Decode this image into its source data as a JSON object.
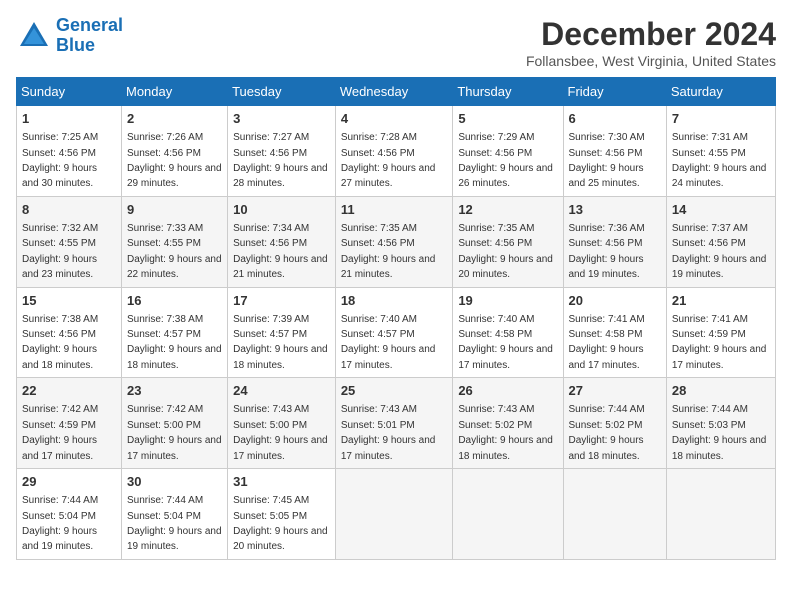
{
  "logo": {
    "line1": "General",
    "line2": "Blue"
  },
  "title": "December 2024",
  "subtitle": "Follansbee, West Virginia, United States",
  "days_of_week": [
    "Sunday",
    "Monday",
    "Tuesday",
    "Wednesday",
    "Thursday",
    "Friday",
    "Saturday"
  ],
  "weeks": [
    [
      {
        "day": "1",
        "sunrise": "7:25 AM",
        "sunset": "4:56 PM",
        "daylight": "9 hours and 30 minutes."
      },
      {
        "day": "2",
        "sunrise": "7:26 AM",
        "sunset": "4:56 PM",
        "daylight": "9 hours and 29 minutes."
      },
      {
        "day": "3",
        "sunrise": "7:27 AM",
        "sunset": "4:56 PM",
        "daylight": "9 hours and 28 minutes."
      },
      {
        "day": "4",
        "sunrise": "7:28 AM",
        "sunset": "4:56 PM",
        "daylight": "9 hours and 27 minutes."
      },
      {
        "day": "5",
        "sunrise": "7:29 AM",
        "sunset": "4:56 PM",
        "daylight": "9 hours and 26 minutes."
      },
      {
        "day": "6",
        "sunrise": "7:30 AM",
        "sunset": "4:56 PM",
        "daylight": "9 hours and 25 minutes."
      },
      {
        "day": "7",
        "sunrise": "7:31 AM",
        "sunset": "4:55 PM",
        "daylight": "9 hours and 24 minutes."
      }
    ],
    [
      {
        "day": "8",
        "sunrise": "7:32 AM",
        "sunset": "4:55 PM",
        "daylight": "9 hours and 23 minutes."
      },
      {
        "day": "9",
        "sunrise": "7:33 AM",
        "sunset": "4:55 PM",
        "daylight": "9 hours and 22 minutes."
      },
      {
        "day": "10",
        "sunrise": "7:34 AM",
        "sunset": "4:56 PM",
        "daylight": "9 hours and 21 minutes."
      },
      {
        "day": "11",
        "sunrise": "7:35 AM",
        "sunset": "4:56 PM",
        "daylight": "9 hours and 21 minutes."
      },
      {
        "day": "12",
        "sunrise": "7:35 AM",
        "sunset": "4:56 PM",
        "daylight": "9 hours and 20 minutes."
      },
      {
        "day": "13",
        "sunrise": "7:36 AM",
        "sunset": "4:56 PM",
        "daylight": "9 hours and 19 minutes."
      },
      {
        "day": "14",
        "sunrise": "7:37 AM",
        "sunset": "4:56 PM",
        "daylight": "9 hours and 19 minutes."
      }
    ],
    [
      {
        "day": "15",
        "sunrise": "7:38 AM",
        "sunset": "4:56 PM",
        "daylight": "9 hours and 18 minutes."
      },
      {
        "day": "16",
        "sunrise": "7:38 AM",
        "sunset": "4:57 PM",
        "daylight": "9 hours and 18 minutes."
      },
      {
        "day": "17",
        "sunrise": "7:39 AM",
        "sunset": "4:57 PM",
        "daylight": "9 hours and 18 minutes."
      },
      {
        "day": "18",
        "sunrise": "7:40 AM",
        "sunset": "4:57 PM",
        "daylight": "9 hours and 17 minutes."
      },
      {
        "day": "19",
        "sunrise": "7:40 AM",
        "sunset": "4:58 PM",
        "daylight": "9 hours and 17 minutes."
      },
      {
        "day": "20",
        "sunrise": "7:41 AM",
        "sunset": "4:58 PM",
        "daylight": "9 hours and 17 minutes."
      },
      {
        "day": "21",
        "sunrise": "7:41 AM",
        "sunset": "4:59 PM",
        "daylight": "9 hours and 17 minutes."
      }
    ],
    [
      {
        "day": "22",
        "sunrise": "7:42 AM",
        "sunset": "4:59 PM",
        "daylight": "9 hours and 17 minutes."
      },
      {
        "day": "23",
        "sunrise": "7:42 AM",
        "sunset": "5:00 PM",
        "daylight": "9 hours and 17 minutes."
      },
      {
        "day": "24",
        "sunrise": "7:43 AM",
        "sunset": "5:00 PM",
        "daylight": "9 hours and 17 minutes."
      },
      {
        "day": "25",
        "sunrise": "7:43 AM",
        "sunset": "5:01 PM",
        "daylight": "9 hours and 17 minutes."
      },
      {
        "day": "26",
        "sunrise": "7:43 AM",
        "sunset": "5:02 PM",
        "daylight": "9 hours and 18 minutes."
      },
      {
        "day": "27",
        "sunrise": "7:44 AM",
        "sunset": "5:02 PM",
        "daylight": "9 hours and 18 minutes."
      },
      {
        "day": "28",
        "sunrise": "7:44 AM",
        "sunset": "5:03 PM",
        "daylight": "9 hours and 18 minutes."
      }
    ],
    [
      {
        "day": "29",
        "sunrise": "7:44 AM",
        "sunset": "5:04 PM",
        "daylight": "9 hours and 19 minutes."
      },
      {
        "day": "30",
        "sunrise": "7:44 AM",
        "sunset": "5:04 PM",
        "daylight": "9 hours and 19 minutes."
      },
      {
        "day": "31",
        "sunrise": "7:45 AM",
        "sunset": "5:05 PM",
        "daylight": "9 hours and 20 minutes."
      },
      null,
      null,
      null,
      null
    ]
  ]
}
